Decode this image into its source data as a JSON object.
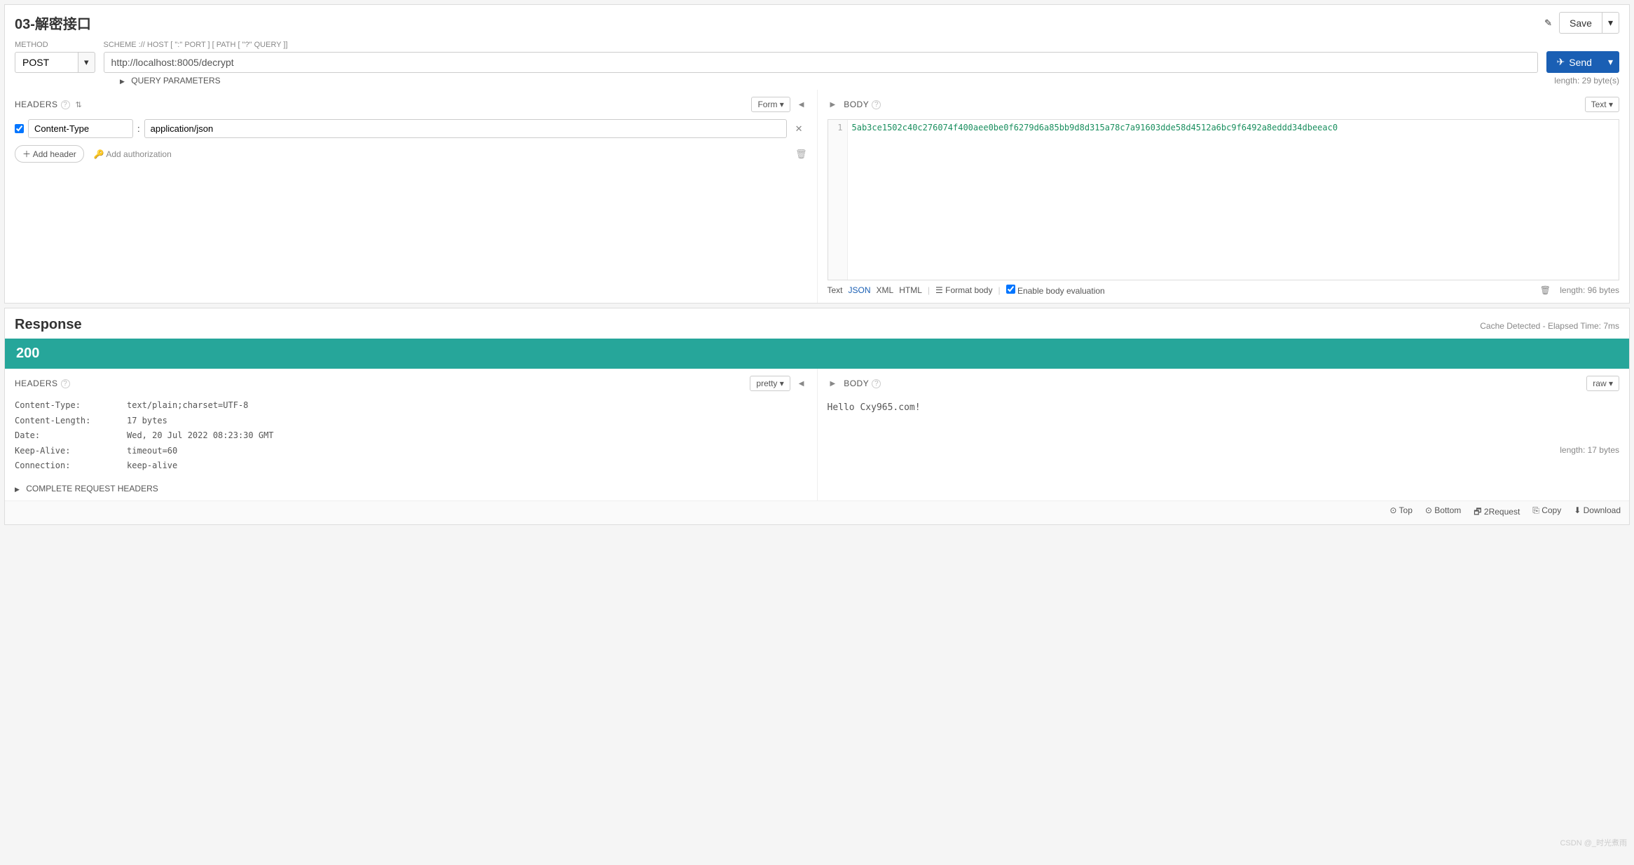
{
  "request": {
    "title": "03-解密接口",
    "save_label": "Save",
    "method_label": "METHOD",
    "method_value": "POST",
    "url_label": "SCHEME :// HOST [ \":\" PORT ] [ PATH [ \"?\" QUERY ]]",
    "url_value": "http://localhost:8005/decrypt",
    "send_label": "Send",
    "query_params_label": "QUERY PARAMETERS",
    "url_length": "length: 29 byte(s)"
  },
  "req_headers": {
    "title": "HEADERS",
    "mode": "Form",
    "rows": [
      {
        "enabled": true,
        "name": "Content-Type",
        "value": "application/json"
      }
    ],
    "add_header": "Add header",
    "add_auth": "Add authorization"
  },
  "req_body": {
    "title": "BODY",
    "mode": "Text",
    "line_no": "1",
    "content": "5ab3ce1502c40c276074f400aee0be0f6279d6a85bb9d8d315a78c7a91603dde58d4512a6bc9f6492a8eddd34dbeeac0",
    "formats": {
      "text": "Text",
      "json": "JSON",
      "xml": "XML",
      "html": "HTML"
    },
    "format_body": "Format body",
    "enable_eval": "Enable body evaluation",
    "length": "length: 96 bytes"
  },
  "response": {
    "title": "Response",
    "meta": "Cache Detected - Elapsed Time: 7ms",
    "status": "200"
  },
  "resp_headers": {
    "title": "HEADERS",
    "mode": "pretty",
    "items": [
      {
        "k": "Content-Type:",
        "v": "text/plain;charset=UTF-8"
      },
      {
        "k": "Content-Length:",
        "v": "17 bytes"
      },
      {
        "k": "Date:",
        "v": "Wed, 20 Jul 2022 08:23:30 GMT"
      },
      {
        "k": "Keep-Alive:",
        "v": "timeout=60"
      },
      {
        "k": "Connection:",
        "v": "keep-alive"
      }
    ],
    "complete": "COMPLETE REQUEST HEADERS"
  },
  "resp_body": {
    "title": "BODY",
    "mode": "raw",
    "content": "Hello Cxy965.com!",
    "length": "length: 17 bytes"
  },
  "footer": {
    "top": "Top",
    "bottom": "Bottom",
    "req": "2Request",
    "copy": "Copy",
    "download": "Download"
  },
  "watermark": "CSDN @_时光煮雨"
}
